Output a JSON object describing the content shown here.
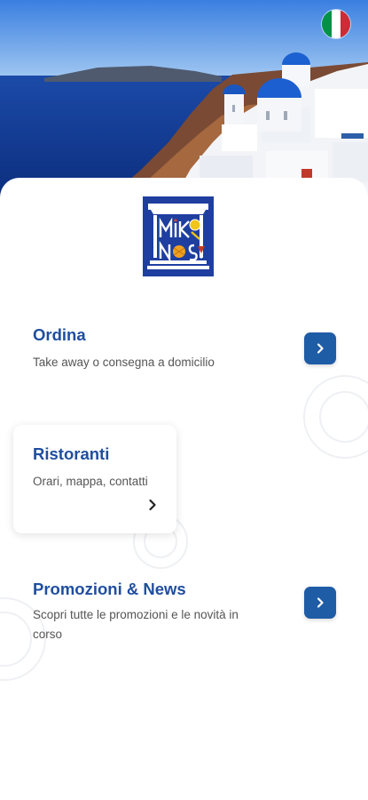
{
  "language": {
    "flag": "italy-flag",
    "colors": [
      "#009246",
      "#ffffff",
      "#ce2b37"
    ]
  },
  "brand": {
    "logo_text": "MIKONOS",
    "logo_color": "#1e3fa0"
  },
  "menu": [
    {
      "title": "Ordina",
      "description": "Take away o consegna a domicilio",
      "icon": "chevron-right-icon"
    },
    {
      "title": "Ristoranti",
      "description": "Orari, mappa, contatti",
      "icon": "chevron-right-icon"
    },
    {
      "title": "Promozioni & News",
      "description": "Scopri tutte le promozioni e le novità in corso",
      "icon": "chevron-right-icon"
    }
  ],
  "colors": {
    "accent": "#1f5ca6",
    "title": "#1f4e9e"
  }
}
